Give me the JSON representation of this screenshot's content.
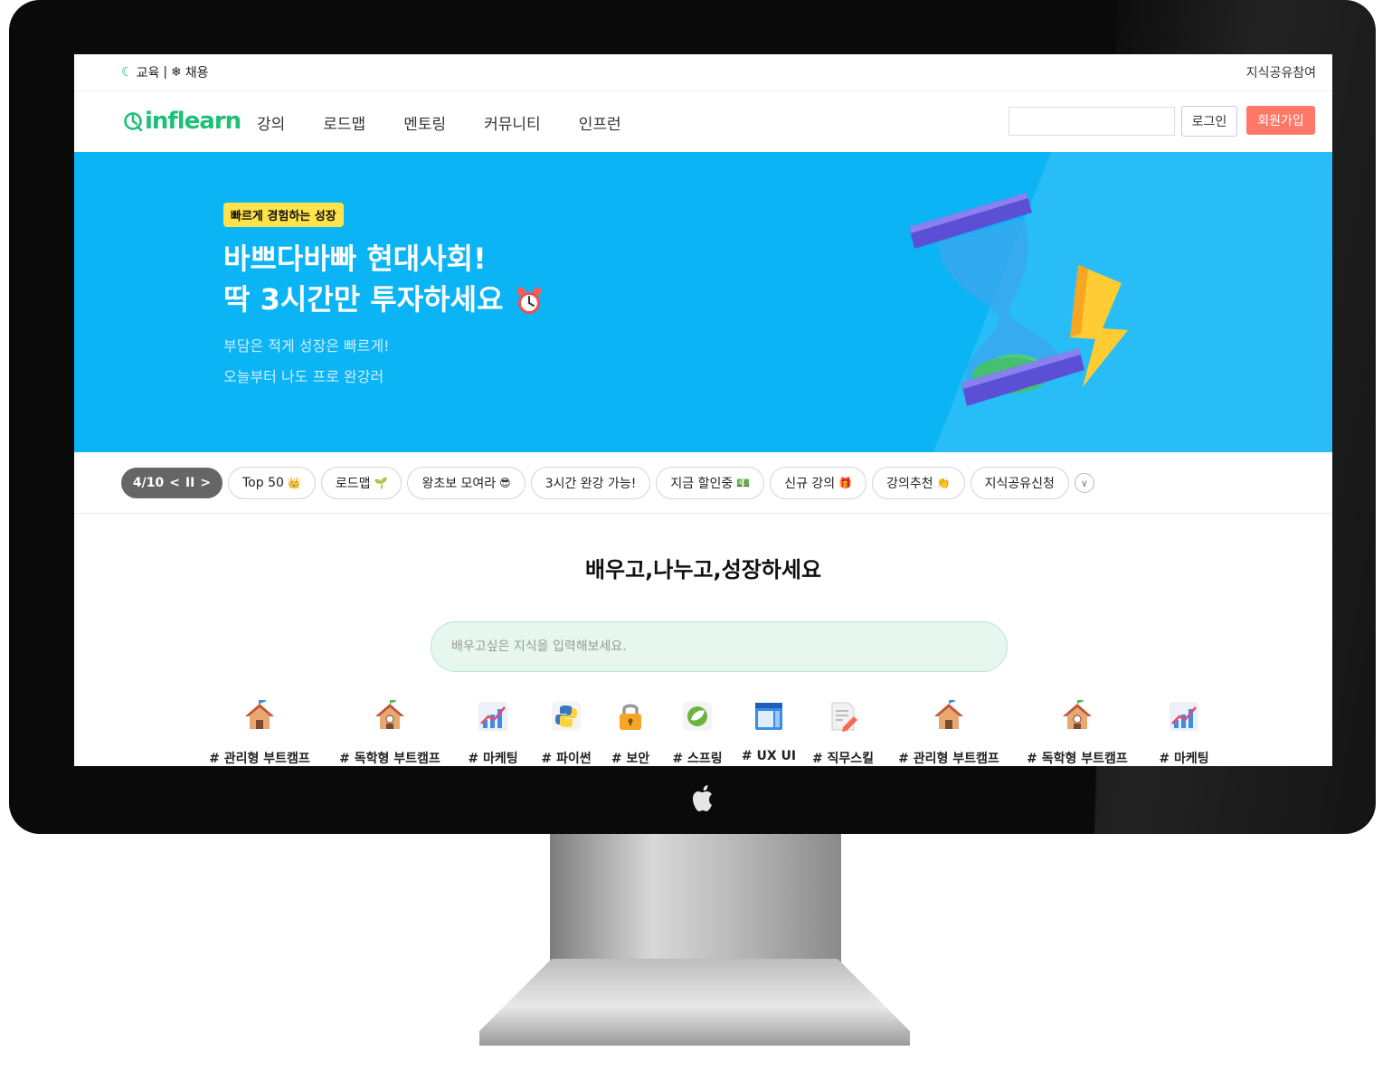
{
  "topbar": {
    "edu_label": "교육",
    "separator": "|",
    "recruit_label": "채용",
    "knowledge_share": "지식공유참여"
  },
  "nav": {
    "logo_text": "inflearn",
    "menu": [
      "강의",
      "로드맵",
      "멘토링",
      "커뮤니티",
      "인프런"
    ],
    "login_label": "로그인",
    "signup_label": "회원가입",
    "search_value": ""
  },
  "banner": {
    "badge": "빠르게 경험하는 성장",
    "title_line1": "바쁘다바빠 현대사회!",
    "title_line2": "딱 3시간만 투자하세요",
    "sub_line1": "부담은 적게 성장은 빠르게!",
    "sub_line2": "오늘부터 나도 프로 완강러",
    "background_color": "#0bb4f5"
  },
  "pager": {
    "current": "4/10",
    "prev": "<",
    "pause": "II",
    "next": ">"
  },
  "chips": [
    {
      "label": "Top 50",
      "emoji": "👑"
    },
    {
      "label": "로드맵",
      "emoji": "🌱"
    },
    {
      "label": "왕초보 모여라",
      "emoji": "😎"
    },
    {
      "label": "3시간 완강 가능!",
      "emoji": ""
    },
    {
      "label": "지금 할인중",
      "emoji": "💵"
    },
    {
      "label": "신규 강의",
      "emoji": "🎁"
    },
    {
      "label": "강의추천",
      "emoji": "👏"
    },
    {
      "label": "지식공유신청",
      "emoji": ""
    }
  ],
  "main": {
    "headline": "배우고,나누고,성장하세요",
    "search_placeholder": "배우고싶은 지식을 입력해보세요.",
    "search_value": ""
  },
  "categories": [
    {
      "label": "# 관리형 부트캠프",
      "icon": "school-house-icon"
    },
    {
      "label": "# 독학형 부트캠프",
      "icon": "school-house-icon"
    },
    {
      "label": "# 마케팅",
      "icon": "chart-up-icon"
    },
    {
      "label": "# 파이썬",
      "icon": "python-icon"
    },
    {
      "label": "# 보안",
      "icon": "lock-icon"
    },
    {
      "label": "# 스프링",
      "icon": "spring-icon"
    },
    {
      "label": "# UX UI",
      "icon": "window-icon"
    },
    {
      "label": "# 직무스킬",
      "icon": "document-pencil-icon"
    },
    {
      "label": "# 관리형 부트캠프",
      "icon": "school-house-icon"
    },
    {
      "label": "# 독학형 부트캠프",
      "icon": "school-house-icon"
    },
    {
      "label": "# 마케팅",
      "icon": "chart-up-icon"
    }
  ],
  "colors": {
    "brand_green": "#1dc078",
    "signup_red": "#ff7867",
    "badge_yellow": "#ffe34a"
  }
}
